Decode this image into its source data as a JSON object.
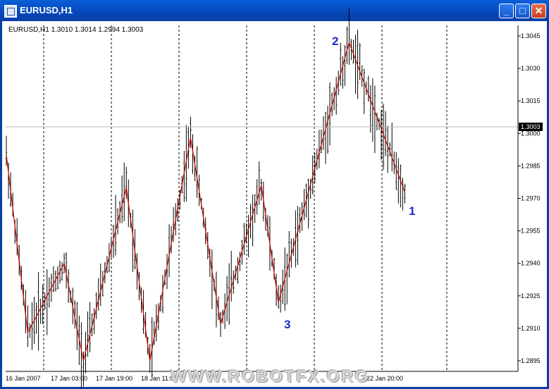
{
  "window": {
    "title": "EURUSD,H1",
    "buttons": {
      "minimize": "_",
      "maximize": "□",
      "close": "✕"
    }
  },
  "chart_header": {
    "symbol": "EURUSD,H1",
    "ohlc": "1.3010 1.3014 1.2994 1.3003",
    "full": "EURUSD,H1  1.3010 1.3014 1.2994 1.3003"
  },
  "annotations": [
    {
      "label": "2",
      "color": "#1c2cc8"
    },
    {
      "label": "1",
      "color": "#1c2cc8"
    },
    {
      "label": "3",
      "color": "#1c2cc8"
    }
  ],
  "watermark": "WWW.ROBOTFX.ORG",
  "chart_data": {
    "type": "line",
    "title": "EURUSD,H1",
    "ylim": [
      1.289,
      1.3052
    ],
    "y_ticks": [
      "1.3045",
      "1.3030",
      "1.3015",
      "1.3000",
      "1.2985",
      "1.2970",
      "1.2955",
      "1.2940",
      "1.2925",
      "1.2910",
      "1.2895"
    ],
    "current_price": "1.3003",
    "x_ticks": [
      "16 Jan 2007",
      "17 Jan 03:00",
      "17 Jan 19:00",
      "18 Jan 11:00",
      "",
      "",
      "",
      "",
      "22 Jan 20:00"
    ],
    "grid": true,
    "zigzag": {
      "name": "",
      "color": "#cc0000",
      "points": [
        {
          "bar": 0,
          "price": 1.299
        },
        {
          "bar": 10,
          "price": 1.2908
        },
        {
          "bar": 27,
          "price": 1.294
        },
        {
          "bar": 36,
          "price": 1.2895
        },
        {
          "bar": 56,
          "price": 1.2975
        },
        {
          "bar": 67,
          "price": 1.2895
        },
        {
          "bar": 86,
          "price": 1.2998
        },
        {
          "bar": 100,
          "price": 1.2912
        },
        {
          "bar": 119,
          "price": 1.2976
        },
        {
          "bar": 127,
          "price": 1.2922
        },
        {
          "bar": 160,
          "price": 1.3042
        },
        {
          "bar": 186,
          "price": 1.2973
        }
      ]
    }
  }
}
